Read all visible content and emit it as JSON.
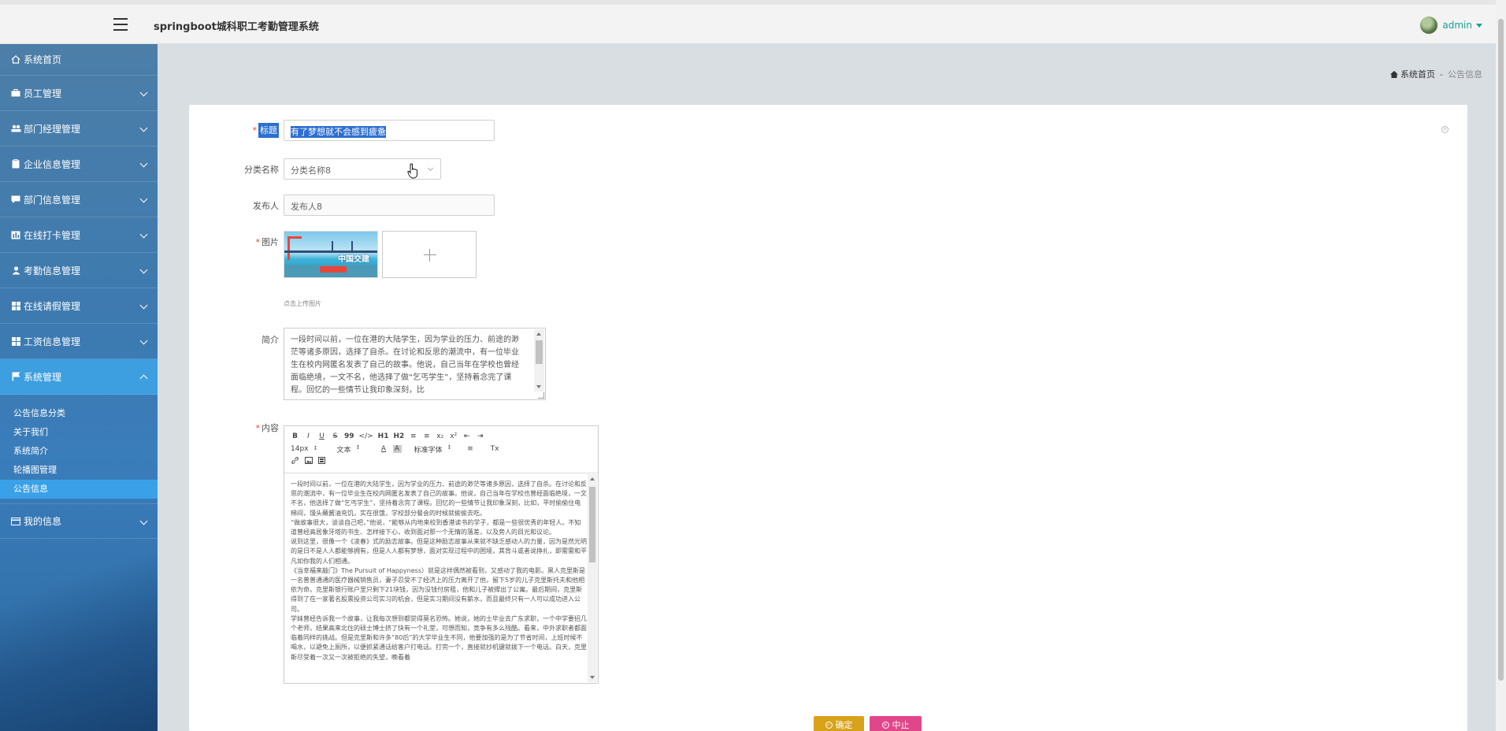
{
  "header": {
    "app_title": "springboot城科职工考勤管理系统",
    "user": "admin"
  },
  "sidebar": {
    "items": [
      {
        "label": "系统首页",
        "icon": "home-icon"
      },
      {
        "label": "员工管理",
        "icon": "briefcase-icon"
      },
      {
        "label": "部门经理管理",
        "icon": "group-icon"
      },
      {
        "label": "企业信息管理",
        "icon": "clipboard-icon"
      },
      {
        "label": "部门信息管理",
        "icon": "chat-icon"
      },
      {
        "label": "在线打卡管理",
        "icon": "chart-icon"
      },
      {
        "label": "考勤信息管理",
        "icon": "user-icon"
      },
      {
        "label": "在线请假管理",
        "icon": "grid-icon"
      },
      {
        "label": "工资信息管理",
        "icon": "grid-icon"
      },
      {
        "label": "系统管理",
        "icon": "flag-icon"
      },
      {
        "label": "我的信息",
        "icon": "card-icon"
      }
    ],
    "sub_items": [
      "公告信息分类",
      "关于我们",
      "系统简介",
      "轮播图管理",
      "公告信息"
    ]
  },
  "breadcrumb": {
    "home": "系统首页",
    "separator": "-",
    "current": "公告信息"
  },
  "form": {
    "title_label": "标题",
    "title_value": "有了梦想就不会感到疲惫",
    "category_label": "分类名称",
    "category_value": "分类名称8",
    "publisher_label": "发布人",
    "publisher_value": "发布人8",
    "image_label": "图片",
    "image_text": "中国交建",
    "upload_hint": "点击上传图片",
    "intro_label": "简介",
    "intro_text": "一段时间以前，一位在港的大陆学生，因为学业的压力、前途的渺茫等诸多原因，选择了自杀。在讨论和反思的潮流中，有一位毕业生在校内网匿名发表了自己的故事。他说，自己当年在学校也曾经面临绝境，一文不名，他选择了做“乞丐学生”，坚持着念完了课程。回忆的一些情节让我印象深刻，比",
    "content_label": "内容",
    "toolbar": {
      "row1": [
        "B",
        "I",
        "U",
        "S",
        "99",
        "</>",
        "H1",
        "H2",
        "≡",
        "≡",
        "x₂",
        "x²",
        "⇤",
        "⇥"
      ],
      "font_size": "14px",
      "format": "文本",
      "font_family": "标准字体",
      "row2_tail": [
        "A",
        "A",
        "≡",
        "Tx"
      ],
      "row3": [
        "link",
        "image",
        "video"
      ]
    },
    "content_paragraphs": [
      "一段时间以前，一位在港的大陆学生，因为学业的压力、前途的渺茫等诸多原因，选择了自杀。在讨论和反思的潮流中，有一位毕业生在校内网匿名发表了自己的故事。他说，自己当年在学校也曾经面临绝境，一文不名，他选择了做“乞丐学生”，坚持着念完了课程。回忆的一些情节让我印象深刻，比如，平时偷偷住电梯间，馒头蘸酱油充饥，实在很饿，学校部分餐会的时候就偷偷去吃。",
      "“做故事很大，谈谈自己吧，”他说，“能够从内地来校到香港读书的学子，都是一些很优秀的年轻人。不知道曾经高居象牙塔的书生、怎样接下心，收到面对那一个无情的落差，以及旁人的目光和议论。",
      "说到这里，很像一个《凌春》式的励志故事。但是这种励志故事从来就不缺乏感动人的力量，因为是然光明的是日不是人人都能够拥有，但是人人都有梦想，面对实现过程中的困境，其背斗或者说挣扎，即需需和平凡如你我的人们相通。",
      "《当幸福来敲门》The Pursuit of Happyness）就是这样偶然被看到，又感动了我的电影。黑人克里斯是一名普普通通的医疗器械销售员，妻子忍受不了经济上的压力离开了他，留下5岁的儿子克里斯托夫和他相依为命。克里斯银行账户里只剩下21块钱，因为没钱付房租，他和儿子被撵出了公寓。最后期间，克里斯得到了在一家著名股票投资公司实习的机会，但是实习期间没有薪水，而且最终只有一人可以成功进入公司。",
      "学妹曾经告诉我一个故事，让我每次想到都觉得莫名恐怖。她说，她的士毕业去广东求职，一个中学要招几个老师，结果高来北住的硕士博士挤了快有一个礼堂，可想而知，竞争有多么残酷。看来，中外求职者都面临着同样的挑战。但是克里斯和许多“80后”的大学毕业生不同，他要加强的是为了节省时间，上班时候不喝水，以避免上厕所，以便抓紧通话给客户打电话。打完一个，直接就抄机键就拨下一个电话。白天，克里斯尽受着一次又一次被拒绝的失望，晚看着"
    ]
  },
  "buttons": {
    "ok": "确定",
    "cancel": "中止"
  },
  "colors": {
    "sidebar": "#3d7ab0",
    "active": "#3d9ee0",
    "accent": "#1aa094",
    "ok": "#d9a21b",
    "cancel": "#e2468a"
  }
}
